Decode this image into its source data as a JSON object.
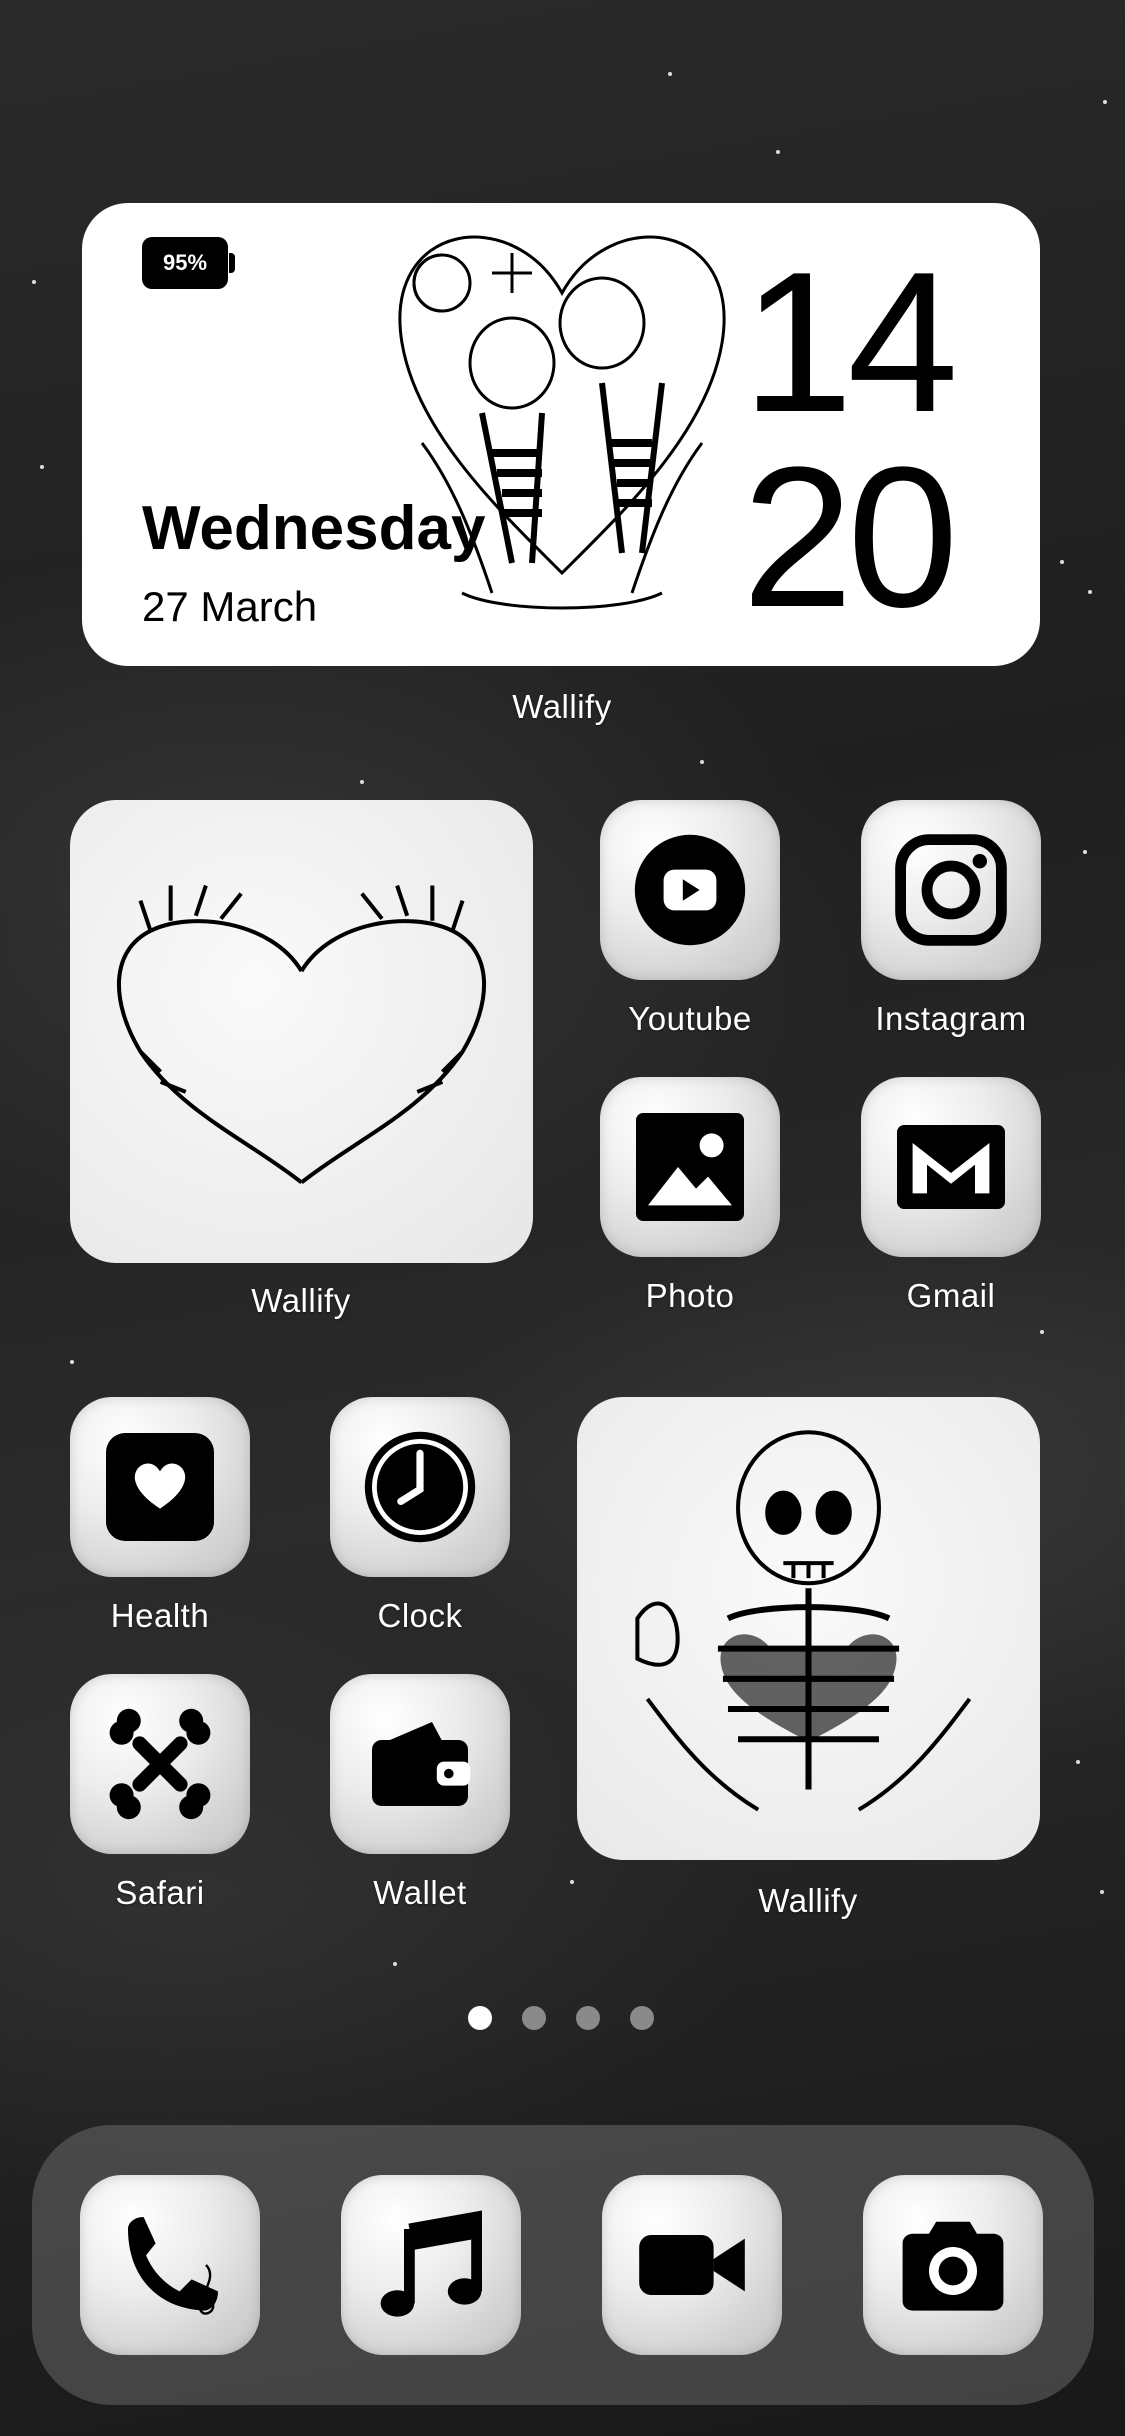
{
  "clock_widget": {
    "battery": "95%",
    "day": "Wednesday",
    "date": "27 March",
    "hour": "14",
    "minute": "20",
    "label": "Wallify"
  },
  "photo_widget_1": {
    "label": "Wallify",
    "art": "skeleton-hands-heart"
  },
  "photo_widget_2": {
    "label": "Wallify",
    "art": "skeleton-hugging-heart"
  },
  "apps": {
    "youtube": "Youtube",
    "instagram": "Instagram",
    "photo": "Photo",
    "gmail": "Gmail",
    "health": "Health",
    "clock": "Clock",
    "safari": "Safari",
    "wallet": "Wallet"
  },
  "dock": {
    "icons": [
      "phone-icon",
      "music-icon",
      "video-camera-icon",
      "camera-icon"
    ]
  },
  "page_indicator": {
    "count": 4,
    "active": 1
  },
  "colors": {
    "icon_black": "#000000",
    "widget_white": "#ffffff"
  }
}
